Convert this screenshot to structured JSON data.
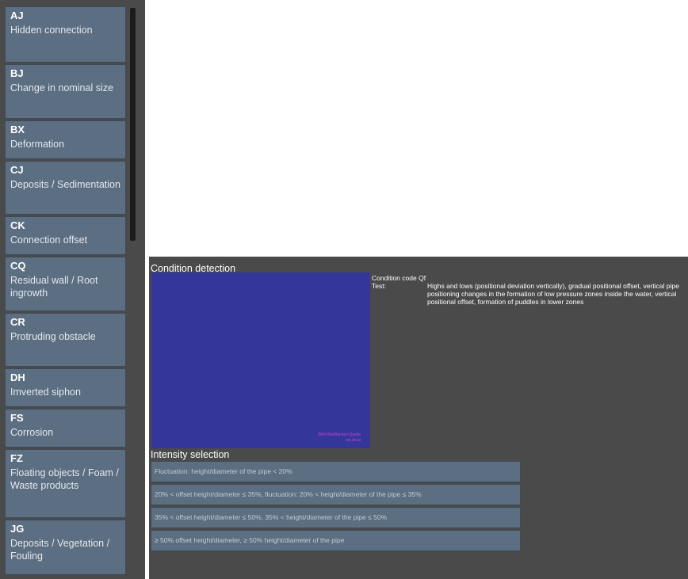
{
  "sidebar": {
    "items": [
      {
        "code": "AJ",
        "label": "Hidden connection"
      },
      {
        "code": "BJ",
        "label": "Change in nominal size"
      },
      {
        "code": "BX",
        "label": "Deformation"
      },
      {
        "code": "CJ",
        "label": "Deposits / Sedimentation"
      },
      {
        "code": "CK",
        "label": "Connection offset"
      },
      {
        "code": "CQ",
        "label": "Residual wall / Root ingrowth"
      },
      {
        "code": "CR",
        "label": "Protruding obstacle"
      },
      {
        "code": "DH",
        "label": "Imverted siphon"
      },
      {
        "code": "FS",
        "label": "Corrosion"
      },
      {
        "code": "FZ",
        "label": "Floating objects / Foam / Waste products"
      },
      {
        "code": "JG",
        "label": "Deposits / Vegetation / Fouling"
      }
    ]
  },
  "main": {
    "condition_title": "Condition detection",
    "image_caption": "Bild-Oberflächen-Quelle\nwir.de.at",
    "condition_code_label": "Condition code",
    "condition_code_value": "Qf",
    "test_label": "Test:",
    "test_value": "Highs and lows (positional deviation vertically), gradual positional offset, vertical pipe positioning changes in the formation of low pressure zones inside the water, vertical positional offset, formation of puddles in lower zones",
    "intensity_title": "Intensity selection",
    "intensity_options": [
      "Fluctuation: height/diameter of the pipe < 20%",
      "20% < offset height/diameter ≤ 35%, fluctuation: 20% < height/diameter of the pipe ≤ 35%",
      "35% < offset height/diameter ≤ 50%, 35% < height/diameter of the pipe ≤ 50%",
      "≥ 50% offset height/diameter, ≥ 50% height/diameter of the pipe"
    ]
  },
  "colors": {
    "panel_background": "#4a4a4a",
    "item_background": "#5c6e81",
    "image_background": "#34369a"
  }
}
